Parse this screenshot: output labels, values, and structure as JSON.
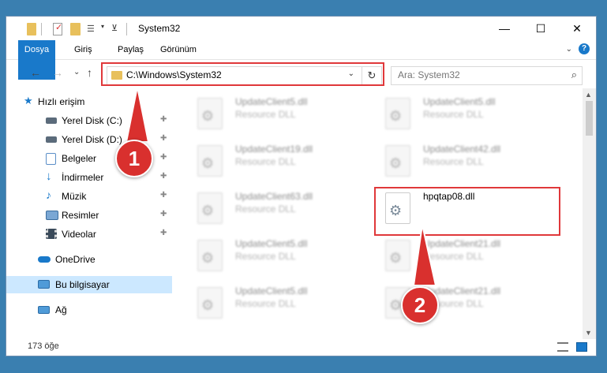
{
  "window": {
    "title": "System32",
    "controls": {
      "minimize": "—",
      "maximize": "☐",
      "close": "✕"
    }
  },
  "ribbon": {
    "tabs": [
      "Dosya",
      "Giriş",
      "Paylaş",
      "Görünüm"
    ],
    "help": "?"
  },
  "nav": {
    "back": "←",
    "forward": "→",
    "recent": "⌄",
    "up": "↑"
  },
  "address": {
    "path": "C:\\Windows\\System32",
    "dropdown": "⌄",
    "refresh": "↻"
  },
  "search": {
    "placeholder": "Ara: System32",
    "icon": "⌕"
  },
  "sidebar": {
    "items": [
      {
        "label": "Hızlı erişim",
        "icon": "star-icon"
      },
      {
        "label": "Yerel Disk (C:)",
        "icon": "drive-icon"
      },
      {
        "label": "Yerel Disk (D:)",
        "icon": "drive-icon"
      },
      {
        "label": "Belgeler",
        "icon": "documents-icon"
      },
      {
        "label": "İndirmeler",
        "icon": "downloads-icon"
      },
      {
        "label": "Müzik",
        "icon": "music-icon"
      },
      {
        "label": "Resimler",
        "icon": "pictures-icon"
      },
      {
        "label": "Videolar",
        "icon": "videos-icon"
      },
      {
        "label": "OneDrive",
        "icon": "cloud-icon"
      },
      {
        "label": "Bu bilgisayar",
        "icon": "computer-icon"
      },
      {
        "label": "Ağ",
        "icon": "network-icon"
      }
    ],
    "pin": "📌"
  },
  "files": [
    {
      "name": "UpdateClient5.dll",
      "desc": "Resource DLL"
    },
    {
      "name": "UpdateClient5.dll",
      "desc": "Resource DLL"
    },
    {
      "name": "UpdateClient19.dll",
      "desc": "Resource DLL"
    },
    {
      "name": "UpdateClient42.dll",
      "desc": "Resource DLL"
    },
    {
      "name": "UpdateClient63.dll",
      "desc": "Resource DLL"
    },
    {
      "name": "hpqtap08.dll",
      "desc": ""
    },
    {
      "name": "UpdateClient5.dll",
      "desc": "Resource DLL"
    },
    {
      "name": "UpdateClient21.dll",
      "desc": "Resource DLL"
    },
    {
      "name": "UpdateClient5.dll",
      "desc": "Resource DLL"
    },
    {
      "name": "UpdateClient21.dll",
      "desc": "Resource DLL"
    }
  ],
  "status": {
    "count": "173 öğe"
  },
  "annotations": {
    "step1": "1",
    "step2": "2",
    "color": "#d9302e"
  },
  "colors": {
    "accent": "#1979ca",
    "selected": "#cce8ff",
    "highlight": "#e0383a"
  }
}
